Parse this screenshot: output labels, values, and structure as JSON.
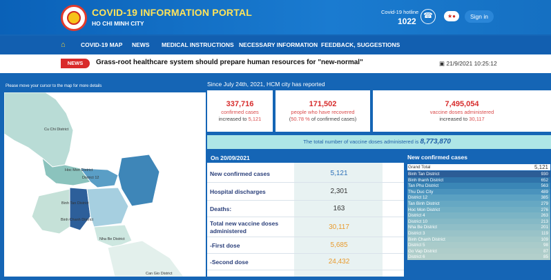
{
  "header": {
    "title": "COVID-19 INFORMATION PORTAL",
    "subtitle": "HO CHI MINH CITY",
    "hotline_label": "Covid-19 hotline",
    "hotline_number": "1022",
    "signin": "Sign in"
  },
  "nav": [
    "COVID-19 MAP",
    "NEWS",
    "MEDICAL INSTRUCTIONS",
    "NECESSARY INFORMATION",
    "FEEDBACK, SUGGESTIONS"
  ],
  "ticker": {
    "badge": "NEWS",
    "headline": "Grass-root healthcare system should prepare human resources for \"new-normal\"",
    "datetime": "21/9/2021 10:25:12"
  },
  "map": {
    "hint": "Please move your cursor to the map for more details",
    "labels": [
      "Cu Chi District",
      "Hoc Mon District",
      "District 12",
      "Binh Tan District",
      "Binh Chanh District",
      "Nha Be District",
      "Can Gio District"
    ]
  },
  "reported_since": "Since July 24th, 2021, HCM city has reported",
  "cards": [
    {
      "num": "337,716",
      "l1": "confirmed cases",
      "l2_pre": "increased to ",
      "l2_hl": "5,121",
      "l2_post": ""
    },
    {
      "num": "171,502",
      "l1": "people who have recovered",
      "l2_pre": "(",
      "l2_hl": "50.78 %",
      "l2_post": " of confirmed cases)"
    },
    {
      "num": "7,495,054",
      "l1": "vaccine doses administered",
      "l2_pre": "increased to ",
      "l2_hl": "30,117",
      "l2_post": ""
    }
  ],
  "total_vaccine": {
    "label": "The total number of vaccine doses administered is",
    "value": "8,773,870"
  },
  "daily": {
    "date": "On 20/09/2021",
    "rows": [
      {
        "label": "New confirmed cases",
        "value": "5,121",
        "color": "#2a6fb8"
      },
      {
        "label": "Hospital discharges",
        "value": "2,301",
        "color": "#333333"
      },
      {
        "label": "Deaths:",
        "value": "163",
        "color": "#333333"
      },
      {
        "label": "Total new vaccine doses administered",
        "value": "30,117",
        "color": "#e89a2c"
      },
      {
        "label": "-First dose",
        "value": "5,685",
        "color": "#e89a2c"
      },
      {
        "label": "-Second dose",
        "value": "24,432",
        "color": "#e89a2c"
      }
    ]
  },
  "new_confirmed": {
    "title": "New confirmed cases",
    "grand_label": "Grand Total",
    "grand_value": "5,121",
    "districts": [
      {
        "name": "Binh Tan District",
        "value": 930
      },
      {
        "name": "Binh thanh District",
        "value": 652
      },
      {
        "name": "Tan Phu District",
        "value": 563
      },
      {
        "name": "Thu Duc City",
        "value": 489
      },
      {
        "name": "District 12",
        "value": 385
      },
      {
        "name": "Tan Binh District",
        "value": 279
      },
      {
        "name": "Hoc Mon District",
        "value": 276
      },
      {
        "name": "District 4",
        "value": 263
      },
      {
        "name": "District 10",
        "value": 213
      },
      {
        "name": "Nha Be District",
        "value": 201
      },
      {
        "name": "District 3",
        "value": 119
      },
      {
        "name": "Binh Chanh District",
        "value": 109
      },
      {
        "name": "District 5",
        "value": 98
      },
      {
        "name": "Go Vap District",
        "value": 87
      },
      {
        "name": "District 6",
        "value": 85
      }
    ]
  }
}
